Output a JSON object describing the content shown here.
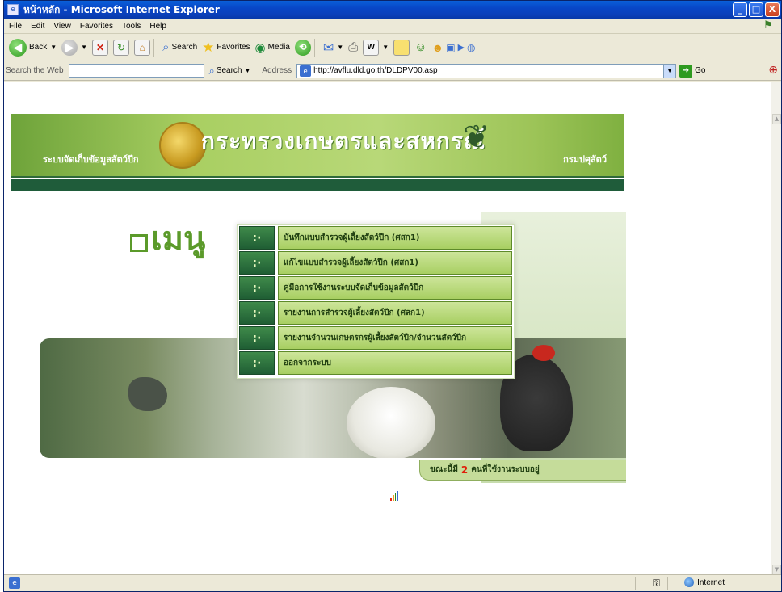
{
  "window": {
    "title": "หน้าหลัก - Microsoft Internet Explorer",
    "buttons": [
      "_",
      "□",
      "X"
    ]
  },
  "menubar": {
    "items": [
      "File",
      "Edit",
      "View",
      "Favorites",
      "Tools",
      "Help"
    ]
  },
  "toolbar": {
    "back_label": "Back",
    "search_label": "Search",
    "favorites_label": "Favorites",
    "media_label": "Media"
  },
  "addressbar": {
    "search_web_label": "Search the Web",
    "search_web_value": "",
    "search_button_label": "Search",
    "address_label": "Address",
    "url": "http://avflu.dld.go.th/DLDPV00.asp",
    "go_label": "Go"
  },
  "banner": {
    "system_label": "ระบบจัดเก็บข้อมูลสัตว์ปีก",
    "ministry": "กระทรวงเกษตรและสหกรณ์",
    "department": "กรมปศุสัตว์"
  },
  "menu": {
    "logo_text": "เมนู",
    "bullet": ":·",
    "items": [
      "บันทึกแบบสำรวจผู้เลี้ยงสัตว์ปีก (ศสก1)",
      "แก้ไขแบบสำรวจผู้เลี้ยงสัตว์ปีก (ศสก1)",
      "คู่มือการใช้งานระบบจัดเก็บข้อมูลสัตว์ปีก",
      "รายงานการสำรวจผู้เลี้ยงสัตว์ปีก (ศสก1)",
      "รายงานจำนวนเกษตรกรผู้เลี้ยงสัตว์ปีก/จำนวนสัตว์ปีก",
      "ออกจากระบบ"
    ]
  },
  "online": {
    "prefix": "ขณะนี้มี",
    "count": "2",
    "suffix": "คนที่ใช้งานระบบอยู่"
  },
  "statusbar": {
    "zone": "Internet"
  }
}
